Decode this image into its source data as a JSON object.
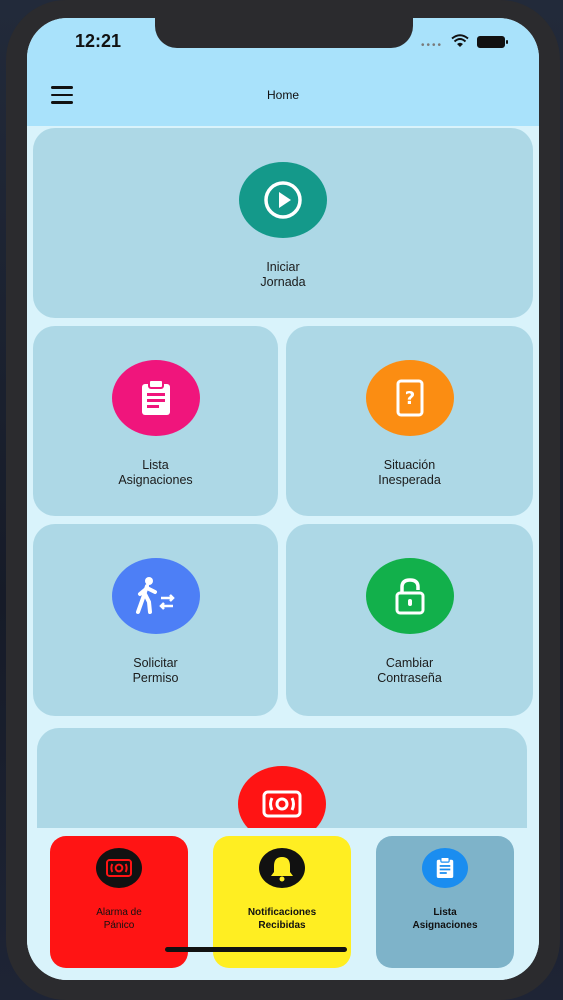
{
  "status_bar": {
    "time": "12:21",
    "signal": "••••"
  },
  "header": {
    "title": "Home"
  },
  "colors": {
    "header_bg": "#a9e2fb",
    "screen_bg": "#d9f3fb",
    "tile_bg": "#add8e6",
    "iniciar": "#14998a",
    "lista": "#f0157c",
    "situacion": "#fb8d12",
    "solicitar": "#4d7ff6",
    "cambiar": "#12b04b",
    "alarma": "#ff1414",
    "notificaciones": "#ffee22",
    "lista_bottom": "#7eb3c9"
  },
  "tiles": {
    "iniciar": {
      "label1": "Iniciar",
      "label2": "Jornada",
      "icon": "play-icon"
    },
    "lista": {
      "label1": "Lista",
      "label2": "Asignaciones",
      "icon": "clipboard-icon"
    },
    "situacion": {
      "label1": "Situación",
      "label2": "Inesperada",
      "icon": "question-tablet-icon"
    },
    "solicitar": {
      "label1": "Solicitar",
      "label2": "Permiso",
      "icon": "walking-person-icon"
    },
    "cambiar": {
      "label1": "Cambiar",
      "label2": "Contraseña",
      "icon": "unlock-icon"
    },
    "alarma": {
      "icon": "alarm-siren-icon"
    }
  },
  "bottom_bar": {
    "alarma": {
      "label1": "Alarma de",
      "label2": "Pánico",
      "icon": "alarm-siren-icon"
    },
    "notificaciones": {
      "label1": "Notificaciones",
      "label2": "Recibidas",
      "icon": "bell-icon"
    },
    "lista": {
      "label1": "Lista",
      "label2": "Asignaciones",
      "icon": "clipboard-icon"
    }
  }
}
